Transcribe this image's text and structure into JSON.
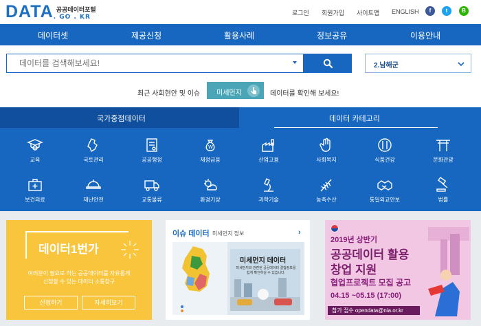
{
  "header": {
    "logo_main": "DATA",
    "logo_sub_top": "공공데이터포털",
    "logo_sub_bottom": ". GO . KR",
    "util_links": [
      "로그인",
      "회원가입",
      "사이트맵",
      "ENGLISH"
    ],
    "sns": [
      "f",
      "t",
      "B"
    ]
  },
  "nav": {
    "items": [
      "데이터셋",
      "제공신청",
      "활용사례",
      "정보공유",
      "이용안내"
    ]
  },
  "search": {
    "placeholder": "데이터를 검색해보세요!",
    "region_select": "2.남해군"
  },
  "issue": {
    "prefix": "최근 사회현안 및 이슈",
    "button_label": "미세먼지",
    "suffix": "데이터를 확인해 보세요!"
  },
  "category_tabs": [
    "국가중점데이터",
    "데이터 카테고리"
  ],
  "categories": [
    {
      "label": "교육",
      "icon": "graduation-cap-icon"
    },
    {
      "label": "국토관리",
      "icon": "map-icon"
    },
    {
      "label": "공공행정",
      "icon": "document-icon"
    },
    {
      "label": "재정금융",
      "icon": "money-bag-icon"
    },
    {
      "label": "산업고용",
      "icon": "factory-icon"
    },
    {
      "label": "사회복지",
      "icon": "hand-icon"
    },
    {
      "label": "식품건강",
      "icon": "food-icon"
    },
    {
      "label": "문화관광",
      "icon": "gate-icon"
    },
    {
      "label": "보건의료",
      "icon": "medical-kit-icon"
    },
    {
      "label": "재난안전",
      "icon": "helmet-icon"
    },
    {
      "label": "교통물류",
      "icon": "truck-icon"
    },
    {
      "label": "환경기상",
      "icon": "weather-icon"
    },
    {
      "label": "과학기술",
      "icon": "microscope-icon"
    },
    {
      "label": "농축수산",
      "icon": "wheat-icon"
    },
    {
      "label": "통일외교안보",
      "icon": "handshake-icon"
    },
    {
      "label": "법률",
      "icon": "gavel-icon"
    }
  ],
  "card_request": {
    "title": "데이터1번가",
    "desc_line1": "여러분이 필요로 하는 공공데이터를 자유롭게",
    "desc_line2": "신청할 수 있는 데이터 소통창구",
    "btn_apply": "신청하기",
    "btn_detail": "자세히보기"
  },
  "card_issue": {
    "title": "이슈 데이터",
    "subtitle": "미세먼지 정보",
    "arrow": "›",
    "image_title": "미세먼지 데이터",
    "image_desc_line1": "미세먼지와 관련된 공공데이터 결합정보를",
    "image_desc_line2": "쉽게 확인하실 수 있습니다."
  },
  "card_banner": {
    "line1": "2019년 상반기",
    "line2": "공공데이터 활용",
    "line3": "창업 지원",
    "line4": "협업프로젝트 모집 공고",
    "dates": "04.15 ~05.15 (17:00)",
    "contact": "참가 접수 opendata@nia.or.kr"
  },
  "colors": {
    "brand_blue": "#1767c1",
    "dark_blue": "#0f4f9d",
    "issue_teal": "#4aa6b7",
    "yellow_card": "#f9c53c",
    "pink_card": "#f2c7e3"
  }
}
